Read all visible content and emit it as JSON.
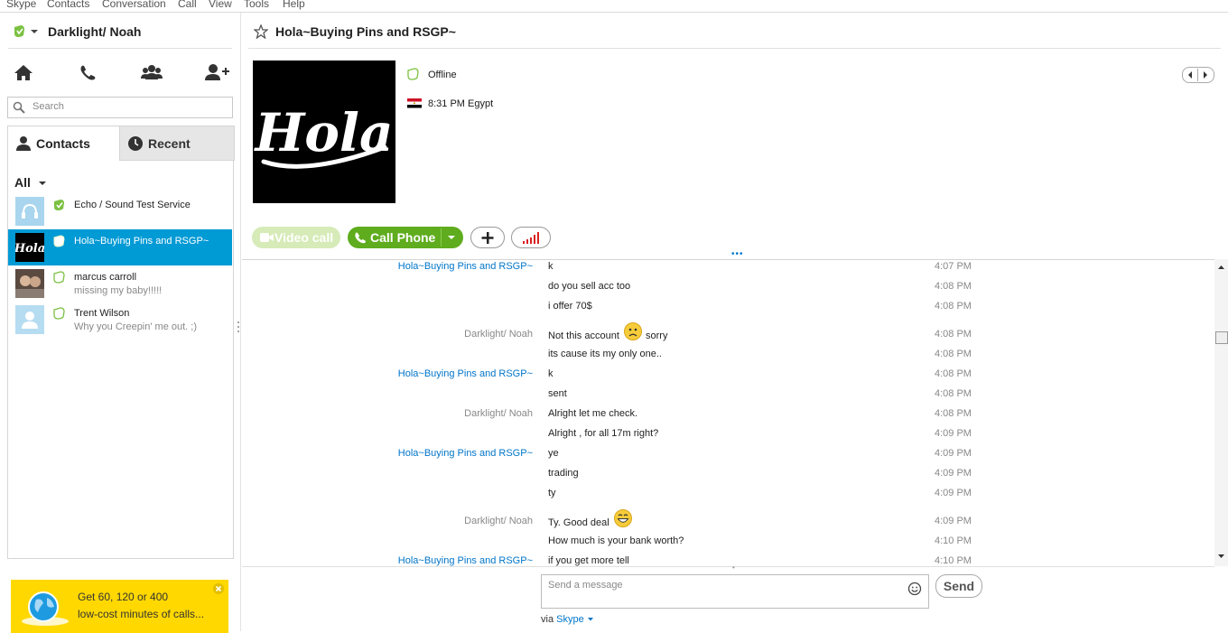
{
  "menu": [
    "Skype",
    "Contacts",
    "Conversation",
    "Call",
    "View",
    "Tools",
    "Help"
  ],
  "profile": {
    "name": "Darklight/ Noah",
    "status_icon": "online-leaf-icon",
    "status_color": "#7cc142"
  },
  "nav_icons": [
    "home-icon",
    "phone-icon",
    "group-icon",
    "add-contact-icon"
  ],
  "search": {
    "placeholder": "Search"
  },
  "tabs": {
    "contacts": "Contacts",
    "recent": "Recent"
  },
  "filter": {
    "label": "All"
  },
  "contacts": [
    {
      "name": "Echo / Sound Test Service",
      "mood": "",
      "status": "online",
      "selected": false
    },
    {
      "name": "Hola~Buying Pins and RSGP~",
      "mood": "",
      "status": "offline",
      "selected": true
    },
    {
      "name": "marcus carroll",
      "mood": "missing my baby!!!!!",
      "status": "offline",
      "selected": false
    },
    {
      "name": "Trent Wilson",
      "mood": "Why you Creepin' me out. ;)",
      "status": "offline",
      "selected": false
    }
  ],
  "promo": {
    "line1": "Get 60, 120 or 400",
    "line2": "low-cost minutes of calls..."
  },
  "chat": {
    "title": "Hola~Buying Pins and RSGP~",
    "presence": "Offline",
    "local_time": "8:31 PM Egypt",
    "logo_text": "Hola",
    "buttons": {
      "video": "Video call",
      "call": "Call Phone"
    },
    "accent": "#5fac1e",
    "link_color": "#0075c9"
  },
  "messages": [
    {
      "sender": "Hola~Buying Pins and RSGP~",
      "who": "them",
      "text": "k",
      "time": "4:07 PM"
    },
    {
      "sender": "",
      "who": "them",
      "text": "do you sell acc too",
      "time": "4:08 PM"
    },
    {
      "sender": "",
      "who": "them",
      "text": "i offer 70$",
      "time": "4:08 PM"
    },
    {
      "sender": "Darklight/ Noah",
      "who": "me",
      "text": "Not this account",
      "emoticon": "sad",
      "text2": "sorry",
      "time": "4:08 PM"
    },
    {
      "sender": "",
      "who": "me",
      "text": "its cause its my only one..",
      "time": "4:08 PM"
    },
    {
      "sender": "Hola~Buying Pins and RSGP~",
      "who": "them",
      "text": "k",
      "time": "4:08 PM"
    },
    {
      "sender": "",
      "who": "them",
      "text": "sent",
      "time": "4:08 PM"
    },
    {
      "sender": "Darklight/ Noah",
      "who": "me",
      "text": "Alright let me check.",
      "time": "4:08 PM"
    },
    {
      "sender": "",
      "who": "me",
      "text": "Alright , for all 17m right?",
      "time": "4:09 PM"
    },
    {
      "sender": "Hola~Buying Pins and RSGP~",
      "who": "them",
      "text": "ye",
      "time": "4:09 PM"
    },
    {
      "sender": "",
      "who": "them",
      "text": "trading",
      "time": "4:09 PM"
    },
    {
      "sender": "",
      "who": "them",
      "text": "ty",
      "time": "4:09 PM"
    },
    {
      "sender": "Darklight/ Noah",
      "who": "me",
      "text": "Ty. Good deal",
      "emoticon": "grin",
      "time": "4:09 PM"
    },
    {
      "sender": "",
      "who": "me",
      "text": "How much is your bank worth?",
      "time": "4:10 PM"
    },
    {
      "sender": "Hola~Buying Pins and RSGP~",
      "who": "them",
      "text": "if you get more tell",
      "time": "4:10 PM"
    }
  ],
  "composer": {
    "placeholder": "Send a message",
    "send_label": "Send",
    "via_label": "via",
    "via_service": "Skype"
  }
}
